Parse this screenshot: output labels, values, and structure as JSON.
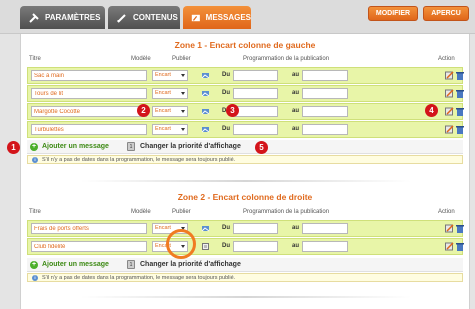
{
  "tabs": [
    {
      "label": "PARAMÈTRES",
      "icon": "tools-icon"
    },
    {
      "label": "CONTENUS",
      "icon": "pencil-icon"
    },
    {
      "label": "MESSAGES",
      "icon": "message-icon"
    }
  ],
  "buttons": {
    "modifier": "MODIFIER",
    "apercu": "APERCU"
  },
  "headers": {
    "titre": "Titre",
    "modele": "Modèle",
    "publier": "Publier",
    "programmation": "Programmation de la publication",
    "action": "Action"
  },
  "labels": {
    "du": "Du",
    "au": "au"
  },
  "zone1": {
    "title": "Zone 1 - Encart colonne de gauche",
    "rows": [
      {
        "title": "Sac à main",
        "model": "Encart"
      },
      {
        "title": "Tours de lit",
        "model": "Encart"
      },
      {
        "title": "Margotte Cocotte",
        "model": "Encart"
      },
      {
        "title": "Turbulettes",
        "model": "Encart"
      }
    ],
    "add_label": "Ajouter un message",
    "priority_label": "Changer la priorité d'affichage",
    "info": "S'il n'y a pas de dates dans la programmation, le message sera toujours publié."
  },
  "zone2": {
    "title": "Zone 2 - Encart colonne de droite",
    "rows": [
      {
        "title": "Frais de ports offerts",
        "model": "Encart"
      },
      {
        "title": "Club fidelité",
        "model": "Encart"
      }
    ],
    "add_label": "Ajouter un message",
    "priority_label": "Changer la priorité d'affichage",
    "info": "S'il n'y a pas de dates dans la programmation, le message sera toujours publié."
  },
  "markers": [
    "1",
    "2",
    "3",
    "4",
    "5"
  ],
  "colors": {
    "accent": "#e06a1e",
    "row_bg": "#e8f5a8",
    "marker": "#d3141a"
  }
}
